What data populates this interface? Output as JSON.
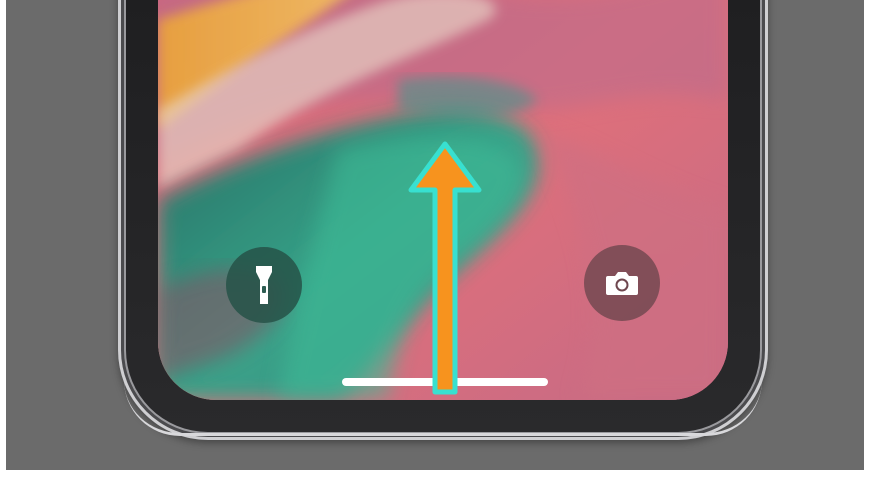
{
  "scene": {
    "description_free": true
  },
  "lock_screen": {
    "quick_actions": [
      {
        "id": "flashlight",
        "icon": "flashlight-icon"
      },
      {
        "id": "camera",
        "icon": "camera-icon"
      }
    ],
    "home_indicator": {
      "color": "#ffffff"
    }
  },
  "annotation": {
    "arrow_icon": "swipe-up-arrow-icon",
    "arrow_fill": "#f7931e",
    "arrow_outline": "#38e0d0"
  },
  "colors": {
    "backdrop": "#6b6b6b",
    "frame": "#1d1d1f",
    "wallpaper_pink": "#d8697a",
    "wallpaper_teal": "#2f9a84",
    "wallpaper_orange": "#e59a3e"
  }
}
